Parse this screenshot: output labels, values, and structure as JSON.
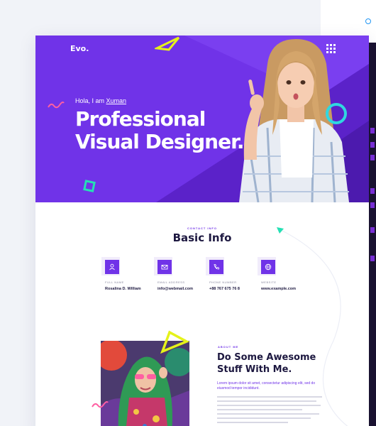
{
  "hero": {
    "logo": "Evo.",
    "greeting_prefix": "Hola, I am ",
    "greeting_name": "Xuman",
    "title_line1": "Professional",
    "title_line2": "Visual Designer.",
    "background_color": "#7033e8"
  },
  "info": {
    "eyebrow": "CONTACT INFO",
    "title": "Basic Info",
    "items": [
      {
        "icon": "user-icon",
        "label": "FULL NAME",
        "value": "Rosalina D. William"
      },
      {
        "icon": "mail-icon",
        "label": "EMAIL ADDRESS",
        "value": "info@webmail.com"
      },
      {
        "icon": "phone-icon",
        "label": "PHONE NUMBER",
        "value": "+88 767 675 76 8"
      },
      {
        "icon": "globe-icon",
        "label": "WEBSITE",
        "value": "www.example.com"
      }
    ]
  },
  "about": {
    "eyebrow": "ABOUT ME",
    "title_line1": "Do Some Awesome",
    "title_line2": "Stuff With Me.",
    "lead": "Lorem ipsum dolor sit amet, consectetur adipiscing elit, sed do eiusmod tempor incididunt."
  },
  "colors": {
    "accent": "#7033e8",
    "heading": "#1d1840",
    "yellow": "#e5f21a",
    "cyan": "#2fd7e0",
    "pink": "#ff5fa2",
    "teal": "#25e0b4"
  }
}
